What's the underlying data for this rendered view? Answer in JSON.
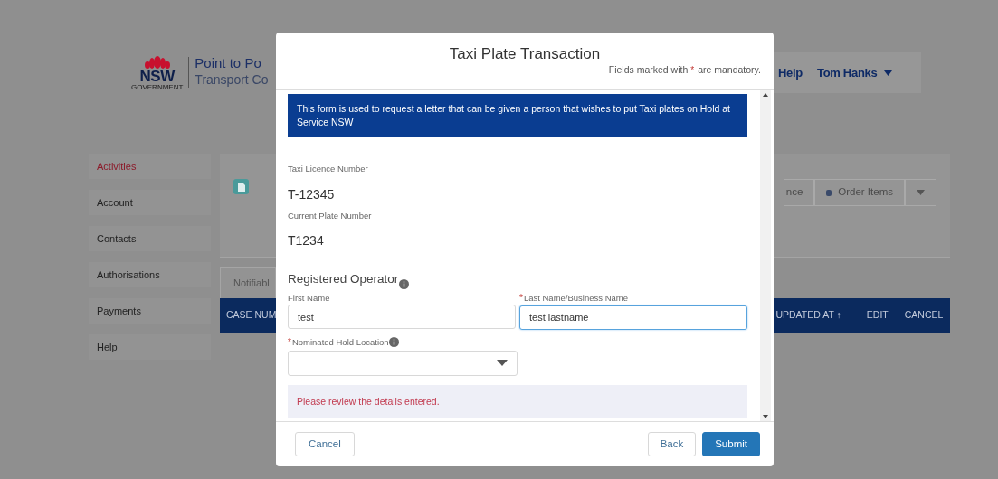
{
  "page": {
    "logo": {
      "mark": "NSW",
      "subtext": "GOVERNMENT",
      "title": "Point to Po",
      "subtitle": "Transport Co"
    },
    "header_links": [
      {
        "label": "Help"
      }
    ],
    "user_menu": {
      "label": "Tom Hanks"
    },
    "sidebar": [
      {
        "label": "Activities",
        "selected": true
      },
      {
        "label": "Account",
        "selected": false
      },
      {
        "label": "Contacts",
        "selected": false
      },
      {
        "label": "Authorisations",
        "selected": false
      },
      {
        "label": "Payments",
        "selected": false
      },
      {
        "label": "Help",
        "selected": false
      }
    ],
    "record_actions": [
      {
        "label": "nce"
      },
      {
        "label": "Order Items"
      }
    ],
    "tabs": [
      {
        "label": "Notifiabl"
      }
    ],
    "table": {
      "columns": [
        "CASE NUM",
        "UPDATED AT ↑",
        "EDIT",
        "CANCEL"
      ]
    }
  },
  "modal": {
    "title": "Taxi Plate Transaction",
    "note": {
      "before": "Fields marked with",
      "marker": "*",
      "after": "are mandatory."
    },
    "info": "This form is used to request a letter that can be given a person that wishes to put Taxi plates on Hold at Service NSW",
    "fields": [
      {
        "label": "Taxi Licence Number",
        "value": "T-12345"
      },
      {
        "label": "Current Plate Number",
        "value": "T1234"
      }
    ],
    "section_title": "Registered Operator",
    "inputs": [
      {
        "label": "First Name",
        "value": "test",
        "focused": false
      },
      {
        "label": "Last Name/Business Name",
        "marker": "*",
        "value": "test lastname",
        "focused": true
      }
    ],
    "select": {
      "label": "Nominated Hold Location",
      "marker": "*"
    },
    "error": "Please review the details entered.",
    "buttons": [
      {
        "label": "Cancel",
        "kind": "secondary"
      },
      {
        "label": "Back",
        "kind": "secondary"
      },
      {
        "label": "Submit",
        "kind": "primary"
      }
    ]
  }
}
